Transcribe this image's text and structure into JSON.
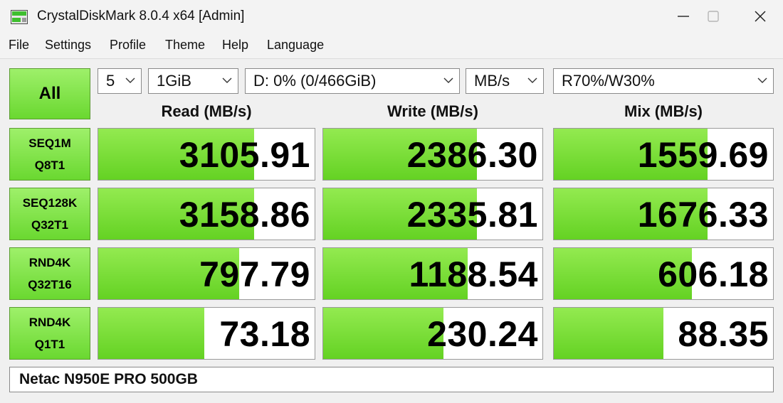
{
  "window": {
    "title": "CrystalDiskMark 8.0.4 x64 [Admin]"
  },
  "menu": [
    "File",
    "Settings",
    "Profile",
    "Theme",
    "Help",
    "Language"
  ],
  "controls": {
    "all_label": "All",
    "test_count": "5",
    "test_size": "1GiB",
    "drive": "D: 0% (0/466GiB)",
    "unit": "MB/s",
    "mix_ratio": "R70%/W30%"
  },
  "headers": {
    "read": "Read (MB/s)",
    "write": "Write (MB/s)",
    "mix": "Mix (MB/s)"
  },
  "tests": [
    {
      "line1": "SEQ1M",
      "line2": "Q8T1",
      "read": "3105.91",
      "write": "2386.30",
      "mix": "1559.69",
      "read_fill": 0.72,
      "write_fill": 0.7,
      "mix_fill": 0.7
    },
    {
      "line1": "SEQ128K",
      "line2": "Q32T1",
      "read": "3158.86",
      "write": "2335.81",
      "mix": "1676.33",
      "read_fill": 0.72,
      "write_fill": 0.7,
      "mix_fill": 0.7
    },
    {
      "line1": "RND4K",
      "line2": "Q32T16",
      "read": "797.79",
      "write": "1188.54",
      "mix": "606.18",
      "read_fill": 0.65,
      "write_fill": 0.66,
      "mix_fill": 0.63
    },
    {
      "line1": "RND4K",
      "line2": "Q1T1",
      "read": "73.18",
      "write": "230.24",
      "mix": "88.35",
      "read_fill": 0.49,
      "write_fill": 0.55,
      "mix_fill": 0.5
    }
  ],
  "comment": "Netac N950E PRO 500GB",
  "colors": {
    "bar_green": "#7ddc3a",
    "button_green": "#8be855"
  }
}
